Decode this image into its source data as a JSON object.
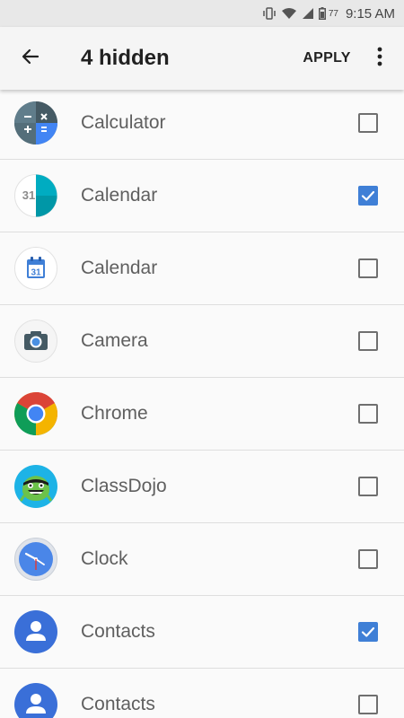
{
  "status_bar": {
    "battery": "77",
    "time": "9:15 AM",
    "icons": [
      "vibrate-icon",
      "wifi-icon",
      "signal-icon",
      "battery-icon"
    ]
  },
  "app_bar": {
    "back_icon": "arrow-back-icon",
    "title": "4 hidden",
    "apply_label": "APPLY",
    "menu_icon": "more-vert-icon"
  },
  "apps": [
    {
      "label": "Calculator",
      "icon": "calculator-icon",
      "checked": false
    },
    {
      "label": "Calendar",
      "icon": "calendar-icon",
      "checked": true
    },
    {
      "label": "Calendar",
      "icon": "google-calendar-icon",
      "checked": false
    },
    {
      "label": "Camera",
      "icon": "camera-icon",
      "checked": false
    },
    {
      "label": "Chrome",
      "icon": "chrome-icon",
      "checked": false
    },
    {
      "label": "ClassDojo",
      "icon": "classdojo-icon",
      "checked": false
    },
    {
      "label": "Clock",
      "icon": "clock-icon",
      "checked": false
    },
    {
      "label": "Contacts",
      "icon": "contacts-icon",
      "checked": true
    },
    {
      "label": "Contacts",
      "icon": "contacts-icon",
      "checked": false
    }
  ],
  "colors": {
    "checkbox_checked": "#3f7fd6",
    "checkbox_unchecked": "#6f6f6f",
    "label_text": "#5f5f5f",
    "title_text": "#212121"
  }
}
